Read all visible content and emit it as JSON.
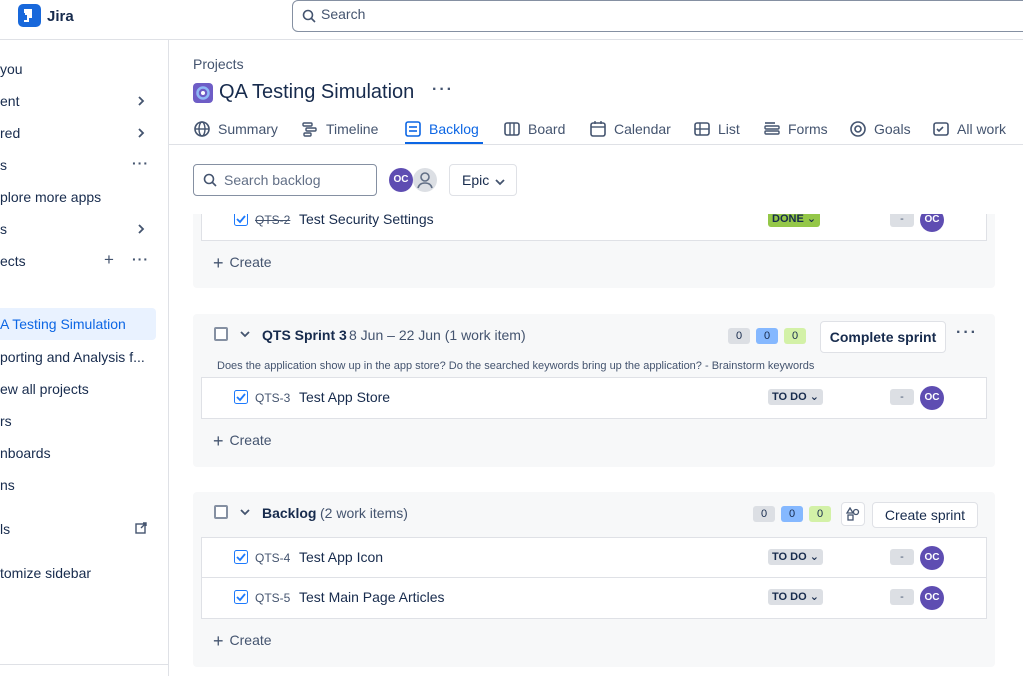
{
  "app": {
    "name": "Jira"
  },
  "search": {
    "placeholder": "Search"
  },
  "sidebar": {
    "items": [
      {
        "label": "you"
      },
      {
        "label": "ent"
      },
      {
        "label": "red"
      },
      {
        "label": "s"
      },
      {
        "label": "plore more apps"
      },
      {
        "label": "s"
      },
      {
        "label": "ects"
      },
      {
        "label": "A Testing Simulation"
      },
      {
        "label": "porting and Analysis f..."
      },
      {
        "label": "ew all projects"
      },
      {
        "label": "rs"
      },
      {
        "label": "nboards"
      },
      {
        "label": "ns"
      },
      {
        "label": "ls"
      },
      {
        "label": "tomize sidebar"
      }
    ]
  },
  "header": {
    "breadcrumb": "Projects",
    "title": "QA Testing Simulation"
  },
  "tabs": [
    {
      "label": "Summary",
      "icon": "globe-icon"
    },
    {
      "label": "Timeline",
      "icon": "timeline-icon"
    },
    {
      "label": "Backlog",
      "icon": "backlog-icon"
    },
    {
      "label": "Board",
      "icon": "board-icon"
    },
    {
      "label": "Calendar",
      "icon": "calendar-icon"
    },
    {
      "label": "List",
      "icon": "list-icon"
    },
    {
      "label": "Forms",
      "icon": "forms-icon"
    },
    {
      "label": "Goals",
      "icon": "goals-icon"
    },
    {
      "label": "All work",
      "icon": "all-work-icon"
    }
  ],
  "toolbar": {
    "search_placeholder": "Search backlog",
    "avatar_initials": "OC",
    "epic_label": "Epic"
  },
  "sprint2": {
    "issues": [
      {
        "key": "QTS-2",
        "summary": "Test Security Settings",
        "status": "DONE",
        "estimate": "-",
        "assignee": "OC"
      }
    ],
    "create_label": "Create"
  },
  "sprint3": {
    "name": "QTS Sprint 3",
    "dates": "8 Jun – 22 Jun (1 work item)",
    "counts": [
      "0",
      "0",
      "0"
    ],
    "complete_label": "Complete sprint",
    "description": "Does the application show up in the app store? Do the searched keywords bring up the application? - Brainstorm keywords",
    "issues": [
      {
        "key": "QTS-3",
        "summary": "Test App Store",
        "status": "TO DO",
        "estimate": "-",
        "assignee": "OC"
      }
    ],
    "create_label": "Create"
  },
  "backlog": {
    "name": "Backlog",
    "count_text": "(2 work items)",
    "counts": [
      "0",
      "0",
      "0"
    ],
    "create_sprint_label": "Create sprint",
    "issues": [
      {
        "key": "QTS-4",
        "summary": "Test App Icon",
        "status": "TO DO",
        "estimate": "-",
        "assignee": "OC"
      },
      {
        "key": "QTS-5",
        "summary": "Test Main Page Articles",
        "status": "TO DO",
        "estimate": "-",
        "assignee": "OC"
      }
    ],
    "create_label": "Create"
  },
  "colors": {
    "accent": "#0c66e4",
    "avatar": "#5e4db2",
    "done": "#94c748"
  }
}
